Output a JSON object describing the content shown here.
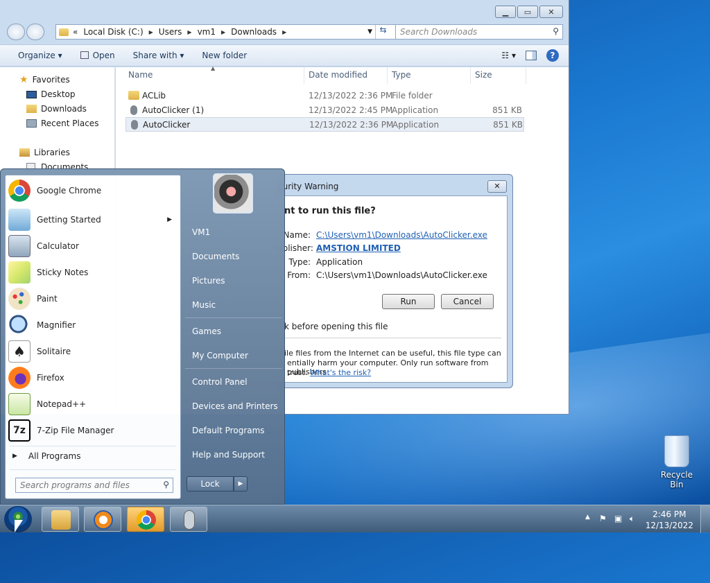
{
  "explorer": {
    "address": {
      "segments": [
        "Local Disk (C:)",
        "Users",
        "vm1",
        "Downloads"
      ],
      "overflow": "«"
    },
    "search_placeholder": "Search Downloads",
    "toolbar": {
      "organize": "Organize",
      "open": "Open",
      "share_with": "Share with",
      "new_folder": "New folder"
    },
    "sidebar": {
      "favorites": "Favorites",
      "items": [
        "Desktop",
        "Downloads",
        "Recent Places"
      ],
      "libraries": "Libraries",
      "documents": "Documents"
    },
    "columns": {
      "name": "Name",
      "date": "Date modified",
      "type": "Type",
      "size": "Size"
    },
    "files": [
      {
        "name": "ACLib",
        "date": "12/13/2022 2:36 PM",
        "type": "File folder",
        "size": ""
      },
      {
        "name": "AutoClicker (1)",
        "date": "12/13/2022 2:45 PM",
        "type": "Application",
        "size": "851 KB"
      },
      {
        "name": "AutoClicker",
        "date": "12/13/2022 2:36 PM",
        "type": "Application",
        "size": "851 KB"
      }
    ]
  },
  "dialog": {
    "title": "curity Warning",
    "question": "nt to run this file?",
    "name_label": "Name:",
    "name_value": "C:\\Users\\vm1\\Downloads\\AutoClicker.exe",
    "publisher_label": "ublisher:",
    "publisher_value": "AMSTION LIMITED",
    "type_label": "Type:",
    "type_value": "Application",
    "from_label": "From:",
    "from_value": "C:\\Users\\vm1\\Downloads\\AutoClicker.exe",
    "run": "Run",
    "cancel": "Cancel",
    "checkbox_text": "k before opening this file",
    "warning_line1": "ile files from the Internet can be useful, this file type can",
    "warning_line2": "entially harm your computer. Only run software from publishers",
    "warning_line3": "trust.",
    "risk_link": "What's the risk?"
  },
  "startmenu": {
    "programs": [
      {
        "label": "Google Chrome",
        "icon": "chrome-icon"
      },
      {
        "label": "Getting Started",
        "icon": "getting-started-icon"
      },
      {
        "label": "Calculator",
        "icon": "calculator-icon"
      },
      {
        "label": "Sticky Notes",
        "icon": "sticky-notes-icon"
      },
      {
        "label": "Paint",
        "icon": "paint-icon"
      },
      {
        "label": "Magnifier",
        "icon": "magnifier-icon"
      },
      {
        "label": "Solitaire",
        "icon": "solitaire-icon"
      },
      {
        "label": "Firefox",
        "icon": "firefox-icon"
      },
      {
        "label": "Notepad++",
        "icon": "notepadpp-icon"
      },
      {
        "label": "7-Zip File Manager",
        "icon": "7zip-icon"
      }
    ],
    "all_programs": "All Programs",
    "search_placeholder": "Search programs and files",
    "right": [
      "VM1",
      "Documents",
      "Pictures",
      "Music",
      "Games",
      "My Computer",
      "Control Panel",
      "Devices and Printers",
      "Default Programs",
      "Help and Support"
    ],
    "lock": "Lock"
  },
  "taskbar": {
    "time": "2:46 PM",
    "date": "12/13/2022"
  },
  "desktop": {
    "recycle_bin": "Recycle Bin"
  },
  "colors": {
    "accent": "#1f5fb4",
    "taskbar_active": "#e49a2a"
  }
}
